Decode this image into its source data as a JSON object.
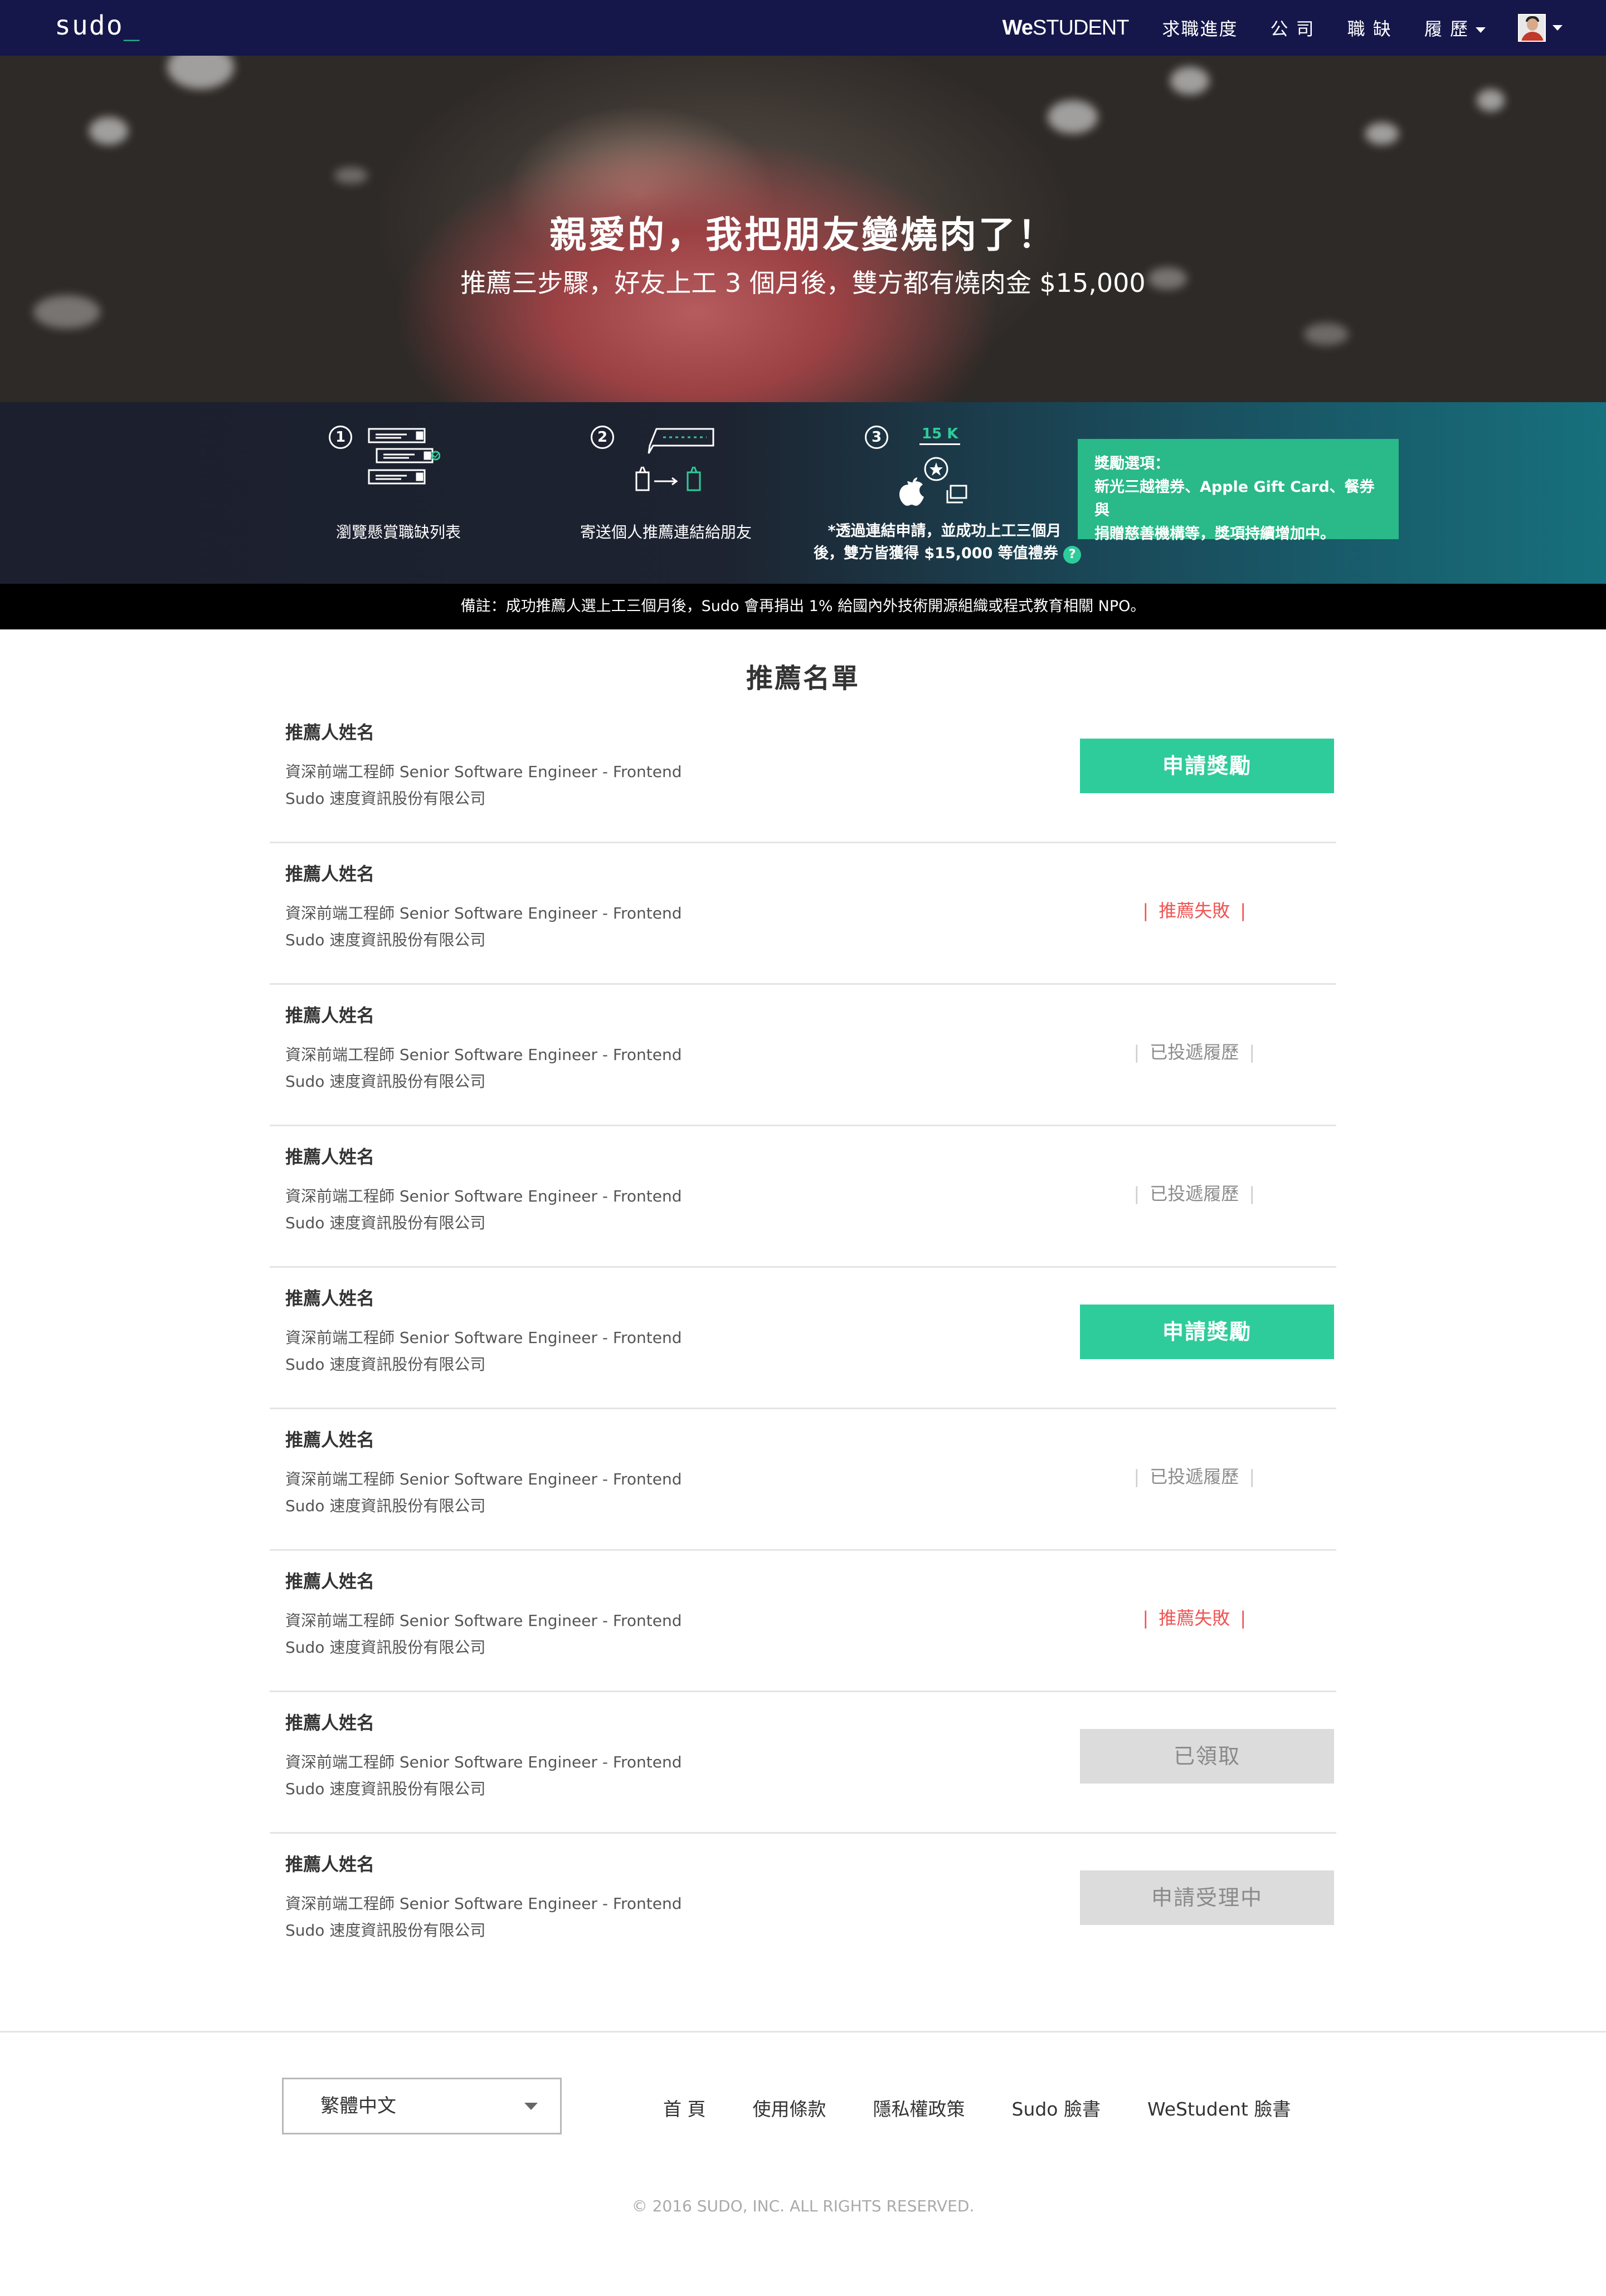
{
  "navbar": {
    "logo": "sudo",
    "logo_cursor": "_",
    "westudent_we": "We",
    "westudent_rest": "STUDENT",
    "items": [
      "求職進度",
      "公 司",
      "職 缺",
      "履 歷"
    ]
  },
  "hero": {
    "title": "親愛的，我把朋友變燒肉了！",
    "subtitle": "推薦三步驟，好友上工 3 個月後，雙方都有燒肉金 $15,000"
  },
  "steps": [
    {
      "num": "1",
      "label": "瀏覽懸賞職缺列表"
    },
    {
      "num": "2",
      "label": "寄送個人推薦連結給朋友"
    },
    {
      "num": "3",
      "badge": "15 K",
      "label_line1": "*透過連結申請，並成功上工三個月",
      "label_line2": "後，雙方皆獲得 $15,000 等值禮券",
      "help": "?"
    }
  ],
  "reward": {
    "line1": "獎勵選項：",
    "line2": "新光三越禮券、Apple Gift Card、餐券與",
    "line3": "捐贈慈善機構等，獎項持續增加中。"
  },
  "note": "備註：成功推薦人選上工三個月後，Sudo 會再捐出 1% 給國內外技術開源組織或程式教育相關 NPO。",
  "list": {
    "title": "推薦名單",
    "rows": [
      {
        "name": "推薦人姓名",
        "job": "資深前端工程師 Senior Software Engineer - Frontend",
        "company": "Sudo 速度資訊股份有限公司",
        "status": "申請獎勵"
      },
      {
        "name": "推薦人姓名",
        "job": "資深前端工程師 Senior Software Engineer - Frontend",
        "company": "Sudo 速度資訊股份有限公司",
        "status": "推薦失敗"
      },
      {
        "name": "推薦人姓名",
        "job": "資深前端工程師 Senior Software Engineer - Frontend",
        "company": "Sudo 速度資訊股份有限公司",
        "status": "已投遞履歷"
      },
      {
        "name": "推薦人姓名",
        "job": "資深前端工程師 Senior Software Engineer - Frontend",
        "company": "Sudo 速度資訊股份有限公司",
        "status": "已投遞履歷"
      },
      {
        "name": "推薦人姓名",
        "job": "資深前端工程師 Senior Software Engineer - Frontend",
        "company": "Sudo 速度資訊股份有限公司",
        "status": "申請獎勵"
      },
      {
        "name": "推薦人姓名",
        "job": "資深前端工程師 Senior Software Engineer - Frontend",
        "company": "Sudo 速度資訊股份有限公司",
        "status": "已投遞履歷"
      },
      {
        "name": "推薦人姓名",
        "job": "資深前端工程師 Senior Software Engineer - Frontend",
        "company": "Sudo 速度資訊股份有限公司",
        "status": "推薦失敗"
      },
      {
        "name": "推薦人姓名",
        "job": "資深前端工程師 Senior Software Engineer - Frontend",
        "company": "Sudo 速度資訊股份有限公司",
        "status": "已領取"
      },
      {
        "name": "推薦人姓名",
        "job": "資深前端工程師 Senior Software Engineer - Frontend",
        "company": "Sudo 速度資訊股份有限公司",
        "status": "申請受理中"
      }
    ]
  },
  "footer": {
    "language": "繁體中文",
    "links": [
      "首 頁",
      "使用條款",
      "隱私權政策",
      "Sudo 臉書",
      "WeStudent 臉書"
    ],
    "copyright": "© 2016 SUDO, INC. ALL RIGHTS RESERVED."
  },
  "colors": {
    "navbar": "#15174a",
    "accent_green": "#2ecc9a",
    "fail_red": "#f05555",
    "disabled_grey": "#dcdcdc"
  }
}
